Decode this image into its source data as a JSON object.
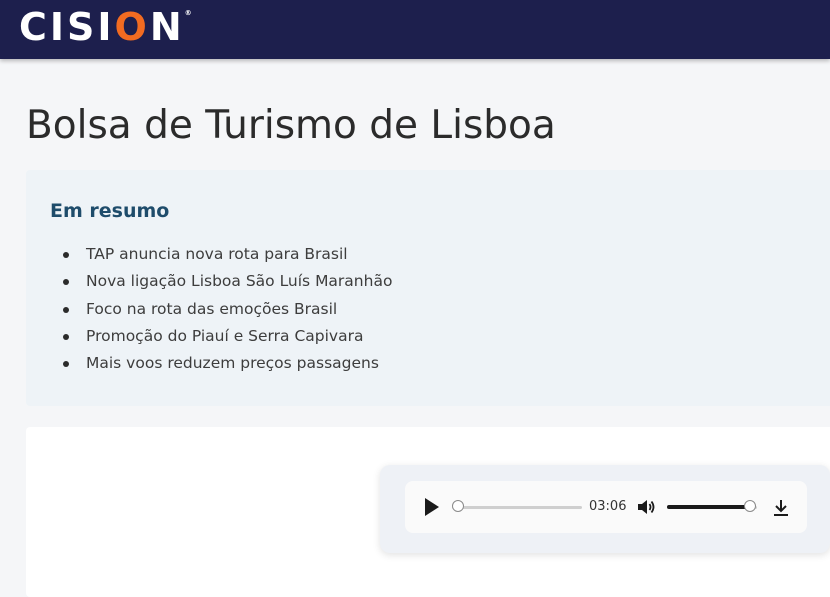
{
  "header": {
    "logo": {
      "before": "CISI",
      "accent": "O",
      "after": "N",
      "trademark": "®"
    },
    "colors": {
      "bar": "#1d1f4d",
      "accent": "#f26b21"
    }
  },
  "page": {
    "title": "Bolsa de Turismo de Lisboa"
  },
  "summary": {
    "heading": "Em resumo",
    "items": [
      "TAP anuncia nova rota para Brasil",
      "Nova ligação Lisboa São Luís Maranhão",
      "Foco na rota das emoções Brasil",
      "Promoção do Piauí e Serra Capivara",
      "Mais voos reduzem preços passagens"
    ]
  },
  "audio_player": {
    "icons": {
      "play": "play-icon",
      "mute": "volume-icon",
      "download": "download-icon"
    },
    "time": "03:06",
    "progress_fraction": 0,
    "volume_fraction": 0.92
  }
}
